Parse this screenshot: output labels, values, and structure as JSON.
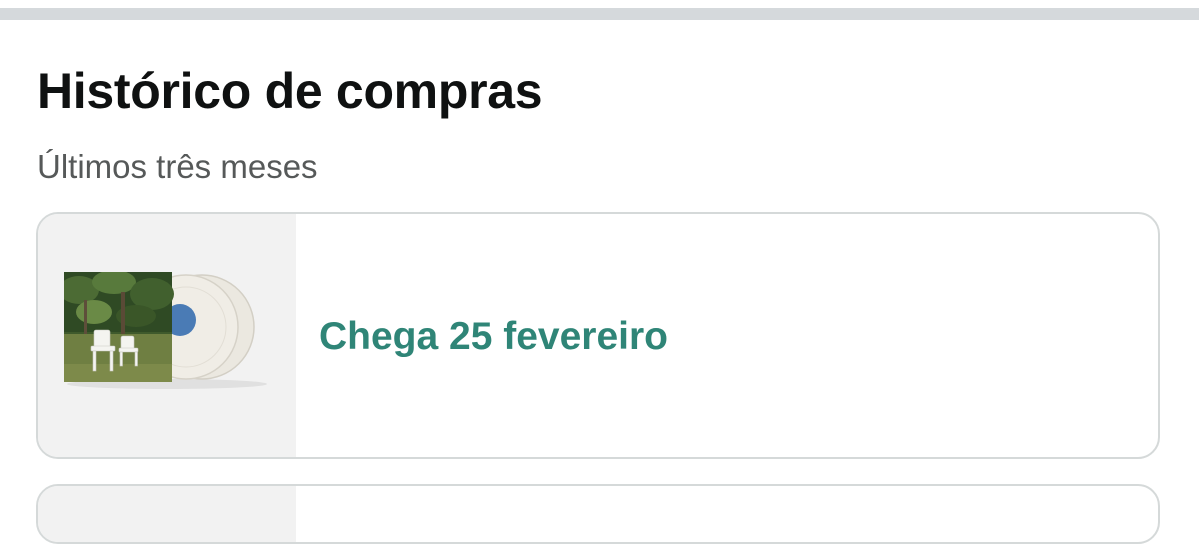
{
  "header": {
    "title": "Histórico de compras",
    "subtitle": "Últimos três meses"
  },
  "orders": [
    {
      "status": "Chega 25 fevereiro",
      "status_color": "#2f8577",
      "thumbnail_icon": "vinyl-album-cover"
    }
  ],
  "colors": {
    "title": "#0f1111",
    "subtitle": "#565959",
    "card_border": "#d5d9d9",
    "thumbnail_bg": "#f2f2f2"
  }
}
